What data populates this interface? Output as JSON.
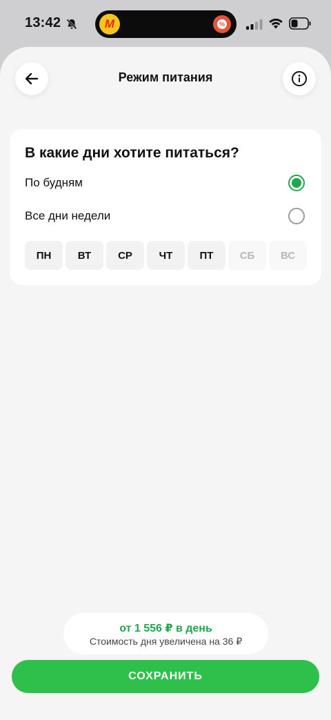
{
  "status_bar": {
    "time": "13:42",
    "icons": [
      "bell-off-icon",
      "cellular-signal-icon",
      "wifi-icon",
      "battery-icon"
    ],
    "island_app_letter": "M",
    "island_badge_symbol": "%"
  },
  "header": {
    "title": "Режим питания",
    "back_icon": "arrow-left-icon",
    "info_icon": "info-icon"
  },
  "schedule": {
    "question": "В какие дни хотите питаться?",
    "options": [
      {
        "label": "По будням",
        "selected": true
      },
      {
        "label": "Все дни недели",
        "selected": false
      }
    ],
    "days": [
      {
        "label": "ПН",
        "active": true
      },
      {
        "label": "ВТ",
        "active": true
      },
      {
        "label": "СР",
        "active": true
      },
      {
        "label": "ЧТ",
        "active": true
      },
      {
        "label": "ПТ",
        "active": true
      },
      {
        "label": "СБ",
        "active": false
      },
      {
        "label": "ВС",
        "active": false
      }
    ]
  },
  "price": {
    "main": "от 1 556 ₽ в день",
    "note": "Стоимость дня увеличена на 36 ₽"
  },
  "actions": {
    "save_label": "СОХРАНИТЬ"
  },
  "colors": {
    "accent_green": "#2fc04b",
    "radio_green": "#1ea84a",
    "background": "#f5f5f6"
  }
}
